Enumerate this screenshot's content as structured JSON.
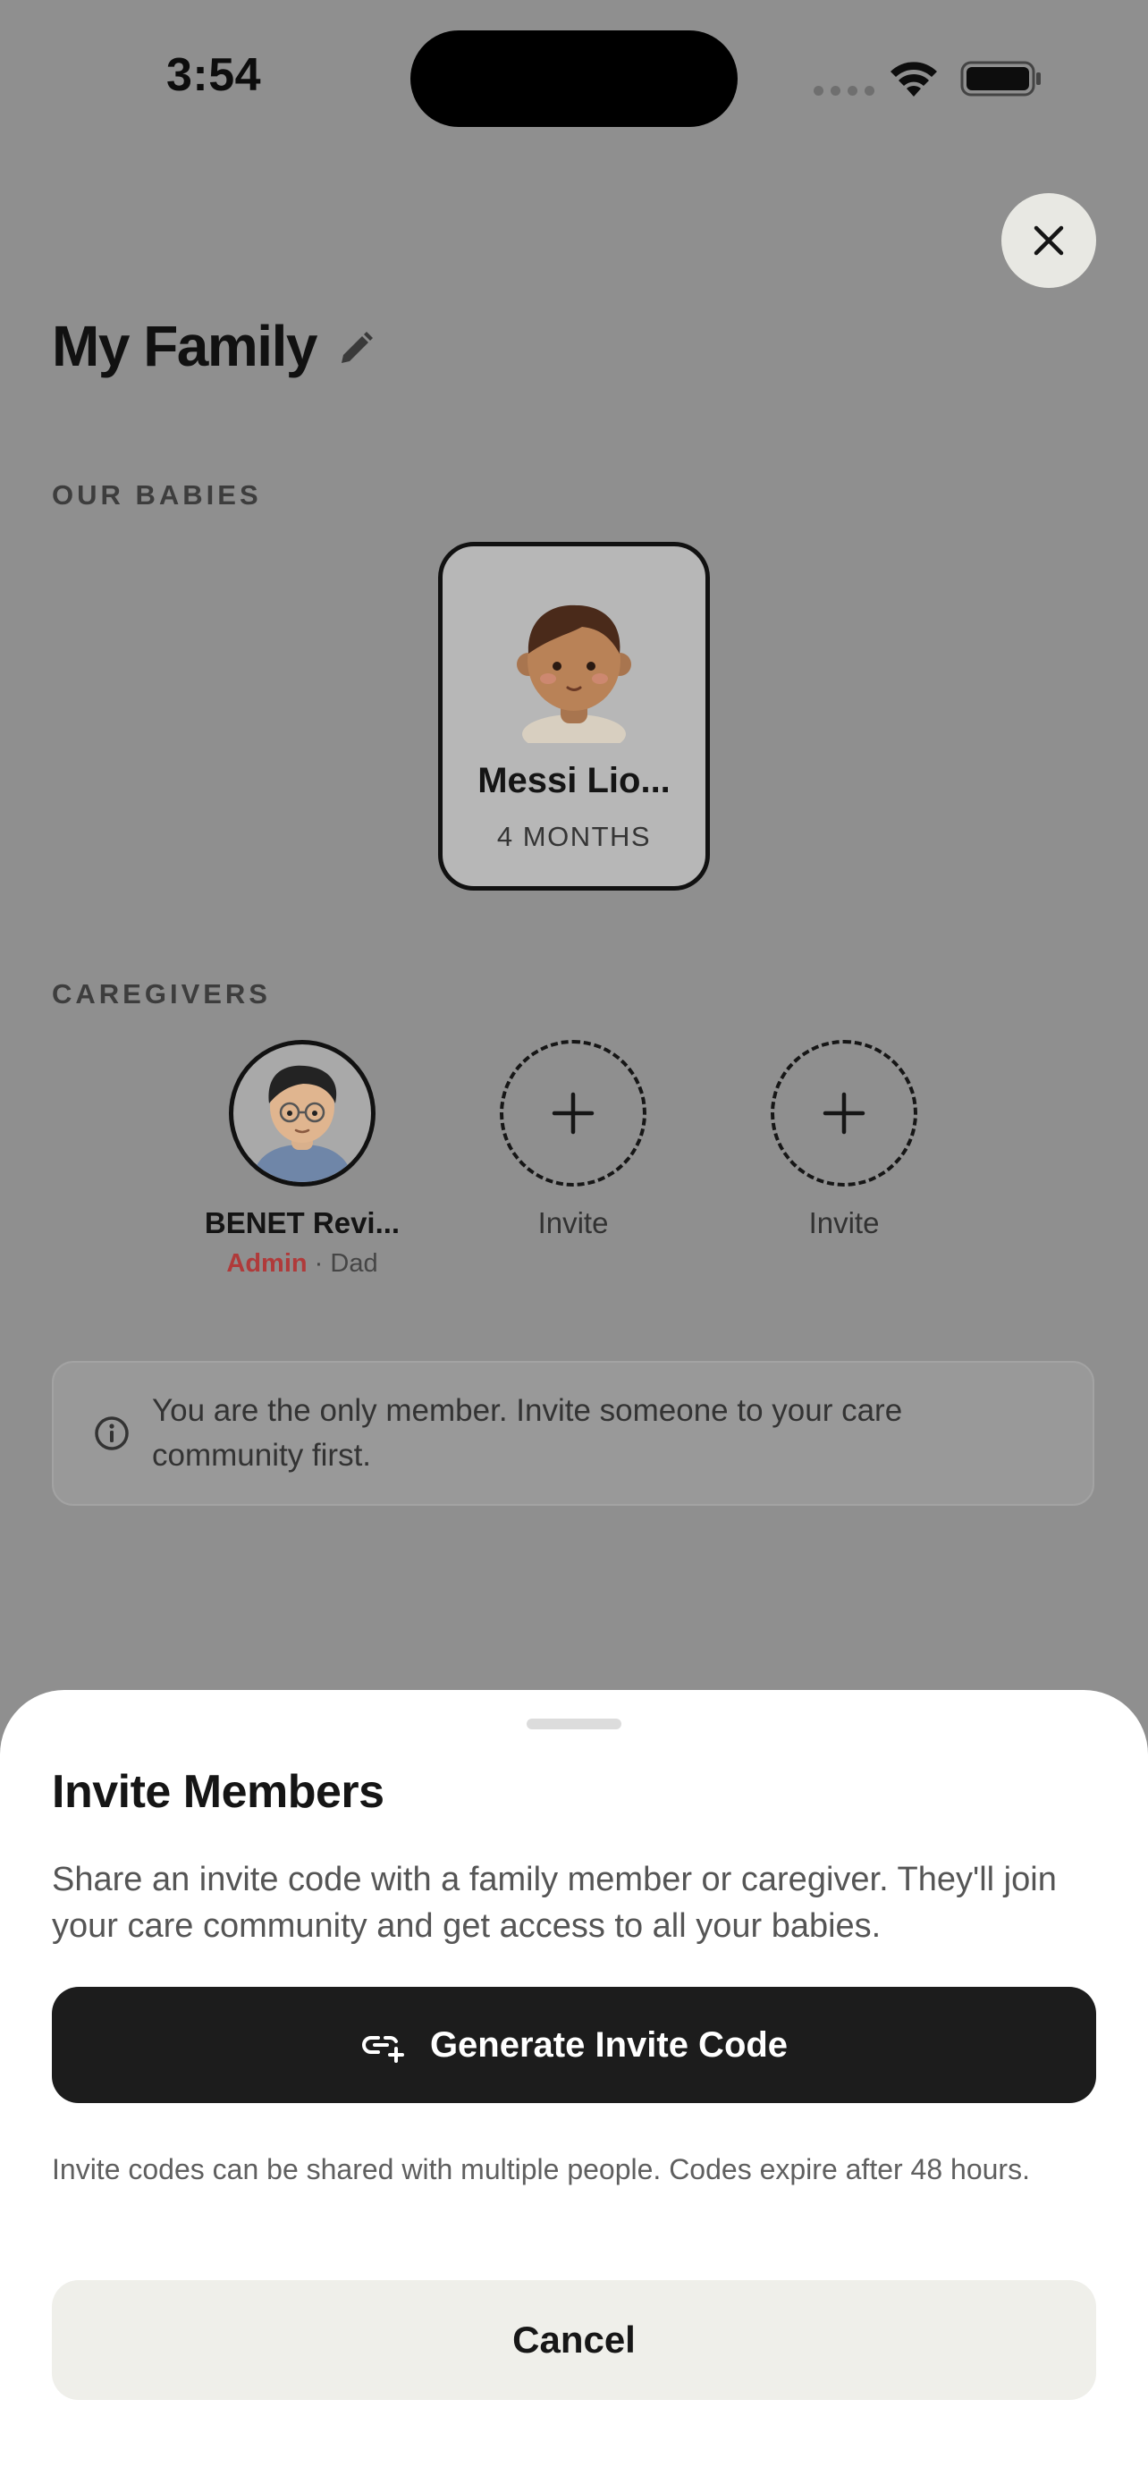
{
  "status_bar": {
    "time": "3:54"
  },
  "header": {
    "title": "My Family"
  },
  "babies": {
    "section_label": "OUR BABIES",
    "items": [
      {
        "name": "Messi Lio...",
        "age": "4 MONTHS"
      }
    ]
  },
  "caregivers": {
    "section_label": "CAREGIVERS",
    "member": {
      "name": "BENET Revi...",
      "role_admin": "Admin",
      "separator": " · ",
      "relation": "Dad"
    },
    "invite_slots": [
      {
        "label": "Invite"
      },
      {
        "label": "Invite"
      }
    ]
  },
  "info": {
    "text": "You are the only member. Invite someone to your care community first."
  },
  "sheet": {
    "title": "Invite Members",
    "description": "Share an invite code with a family member or caregiver. They'll join your care community and get access to all your babies.",
    "generate_label": "Generate Invite Code",
    "note": "Invite codes can be shared with multiple people. Codes expire after 48 hours.",
    "cancel_label": "Cancel"
  },
  "colors": {
    "admin": "#b03a3a",
    "primary_button": "#1c1c1c",
    "overlay": "#8f8f8f"
  },
  "icons": [
    "wifi-icon",
    "battery-icon",
    "close-icon",
    "pencil-icon",
    "plus-icon",
    "info-icon",
    "link-plus-icon"
  ]
}
